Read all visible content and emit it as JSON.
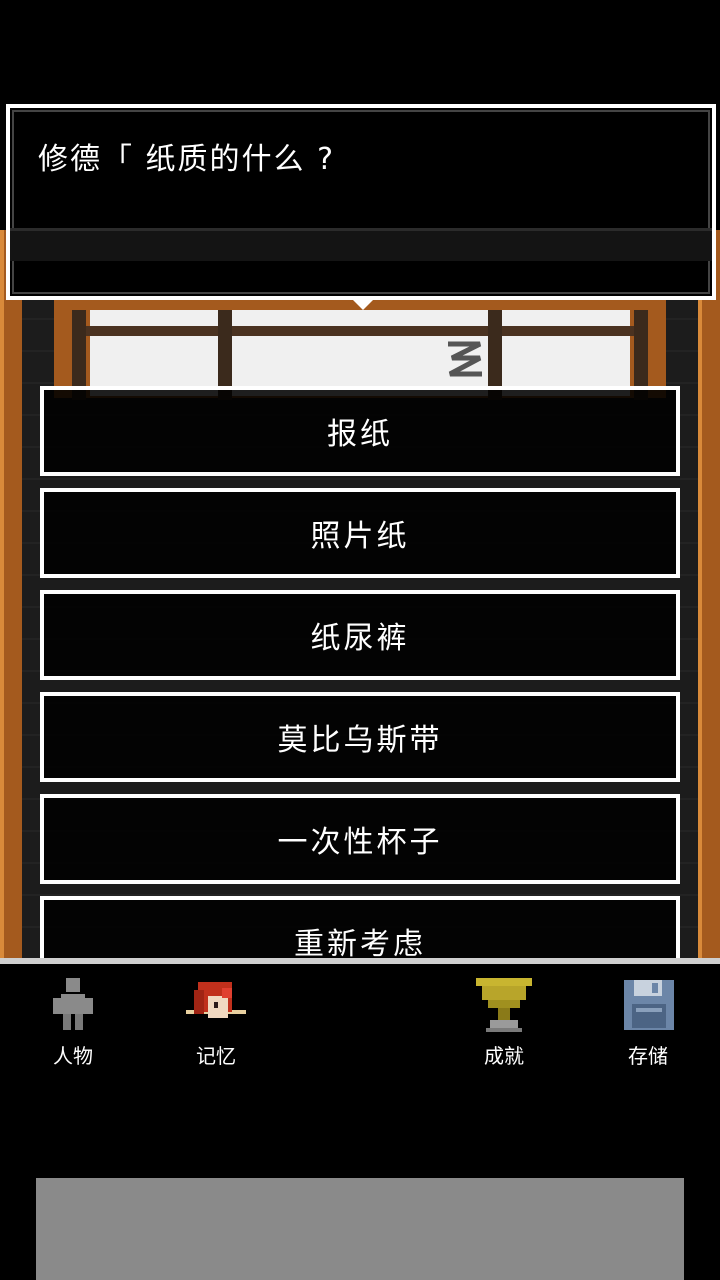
{
  "dialog": {
    "text": "修德「 纸质的什么 ?"
  },
  "choices": [
    {
      "label": "报纸"
    },
    {
      "label": "照片纸"
    },
    {
      "label": "纸尿裤"
    },
    {
      "label": "莫比乌斯带"
    },
    {
      "label": "一次性杯子"
    },
    {
      "label": "重新考虑"
    }
  ],
  "menu": {
    "items": [
      {
        "label": "人物",
        "icon": "person-icon"
      },
      {
        "label": "记忆",
        "icon": "memory-portrait-icon"
      },
      {
        "label": "成就",
        "icon": "trophy-icon"
      },
      {
        "label": "存储",
        "icon": "floppy-disk-icon"
      }
    ]
  },
  "colors": {
    "frame_wood": "#a45a1e",
    "trophy_gold": "#b8a52a",
    "floppy_blue": "#6c86a8",
    "ad_gray": "#8a8a8a"
  }
}
